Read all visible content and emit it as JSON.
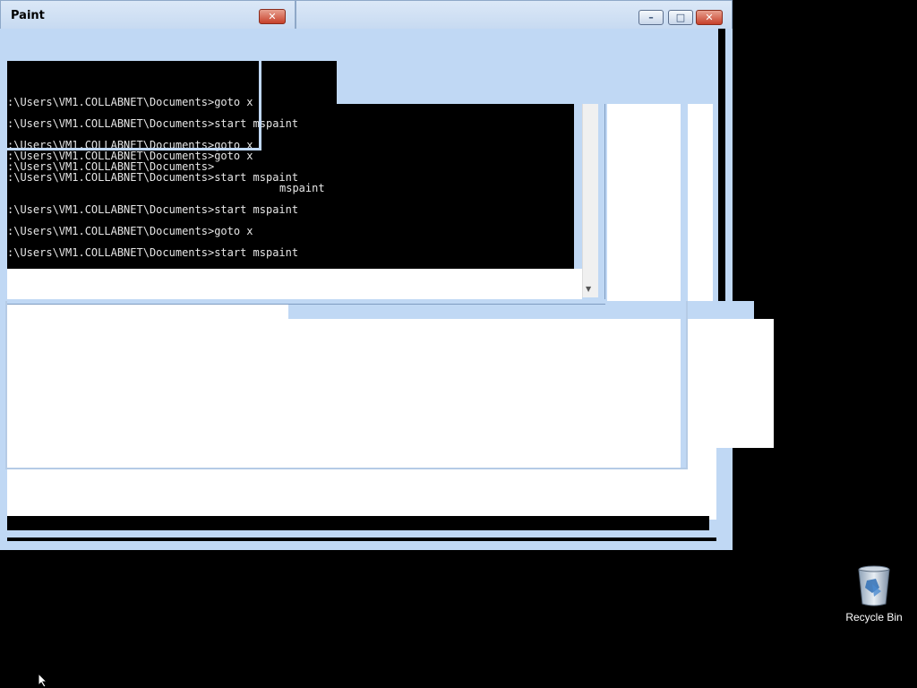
{
  "window": {
    "title": "Paint",
    "minimize_glyph": "–",
    "maximize_glyph": "□",
    "close_glyph": "✕"
  },
  "console": {
    "lines": [
      ":\\Users\\VM1.COLLABNET\\Documents>goto x",
      ":\\Users\\VM1.COLLABNET\\Documents>start mspaint",
      ":\\Users\\VM1.COLLABNET\\Documents>goto x",
      ":\\Users\\VM1.COLLABNET\\Documents>goto x",
      ":\\Users\\VM1.COLLABNET\\Documents>",
      ":\\Users\\VM1.COLLABNET\\Documents>start mspaint",
      "mspaint",
      ":\\Users\\VM1.COLLABNET\\Documents>start mspaint",
      ":\\Users\\VM1.COLLABNET\\Documents>goto x",
      ":\\Users\\VM1.COLLABNET\\Documents>start mspaint"
    ]
  },
  "desktop": {
    "recycle_bin_label": "Recycle Bin",
    "recycle_bin_icon": "recycle-bin-icon",
    "cursor_icon": "mouse-pointer-icon"
  },
  "colors": {
    "desktop": "#000000",
    "window_frame": "#c0d8f4",
    "close_button": "#c7402a"
  }
}
